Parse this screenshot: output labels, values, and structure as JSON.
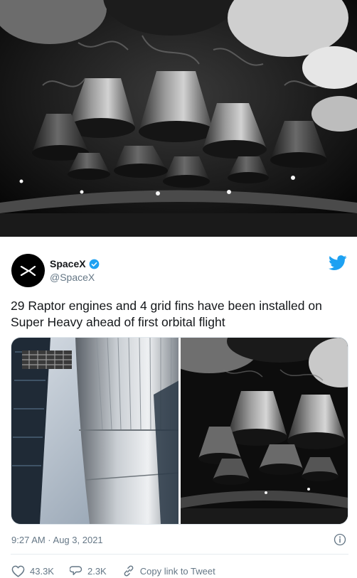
{
  "tweet": {
    "display_name": "SpaceX",
    "handle": "@SpaceX",
    "text": "29 Raptor engines and 4 grid fins have been installed on Super Heavy ahead of first orbital flight",
    "timestamp": "9:27 AM · Aug 3, 2021",
    "likes": "43.3K",
    "replies": "2.3K",
    "share_label": "Copy link to Tweet"
  },
  "icons": {
    "avatar": "spacex-logo-icon",
    "verified": "verified-badge-icon",
    "bird": "twitter-bird-icon",
    "info": "info-icon",
    "like": "heart-icon",
    "reply": "reply-bubble-icon",
    "link": "link-icon"
  },
  "colors": {
    "twitter_blue": "#1da1f2",
    "text": "#14171a",
    "muted": "#657786",
    "divider": "#e6ecf0"
  }
}
